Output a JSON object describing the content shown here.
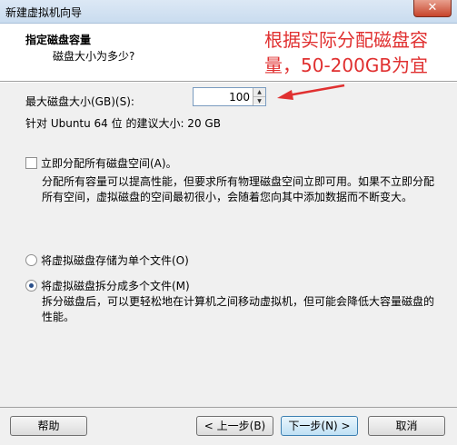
{
  "window": {
    "title": "新建虚拟机向导",
    "close_glyph": "✕"
  },
  "header": {
    "title": "指定磁盘容量",
    "subtitle": "磁盘大小为多少?",
    "annotation": "根据实际分配磁盘容量，50-200GB为宜"
  },
  "disk_size": {
    "label": "最大磁盘大小(GB)(S):",
    "value": "100",
    "recommended": "针对 Ubuntu 64 位 的建议大小: 20 GB"
  },
  "allocate_now": {
    "checked": false,
    "label": "立即分配所有磁盘空间(A)。",
    "description": "分配所有容量可以提高性能，但要求所有物理磁盘空间立即可用。如果不立即分配所有空间，虚拟磁盘的空间最初很小，会随着您向其中添加数据而不断变大。"
  },
  "storage_mode": {
    "single_file_label": "将虚拟磁盘存储为单个文件(O)",
    "multi_file_label": "将虚拟磁盘拆分成多个文件(M)",
    "selected": "multi",
    "multi_description": "拆分磁盘后，可以更轻松地在计算机之间移动虚拟机，但可能会降低大容量磁盘的性能。"
  },
  "footer": {
    "help": "帮助",
    "back": "< 上一步(B)",
    "next": "下一步(N) >",
    "cancel": "取消"
  },
  "colors": {
    "annotation": "#e03030",
    "header_bg": "#ffffff",
    "body_bg": "#f0f0f0"
  },
  "icons": {
    "annotation_arrow": "red-arrow-icon",
    "spin_up": "up-arrow-icon",
    "spin_down": "down-arrow-icon"
  }
}
